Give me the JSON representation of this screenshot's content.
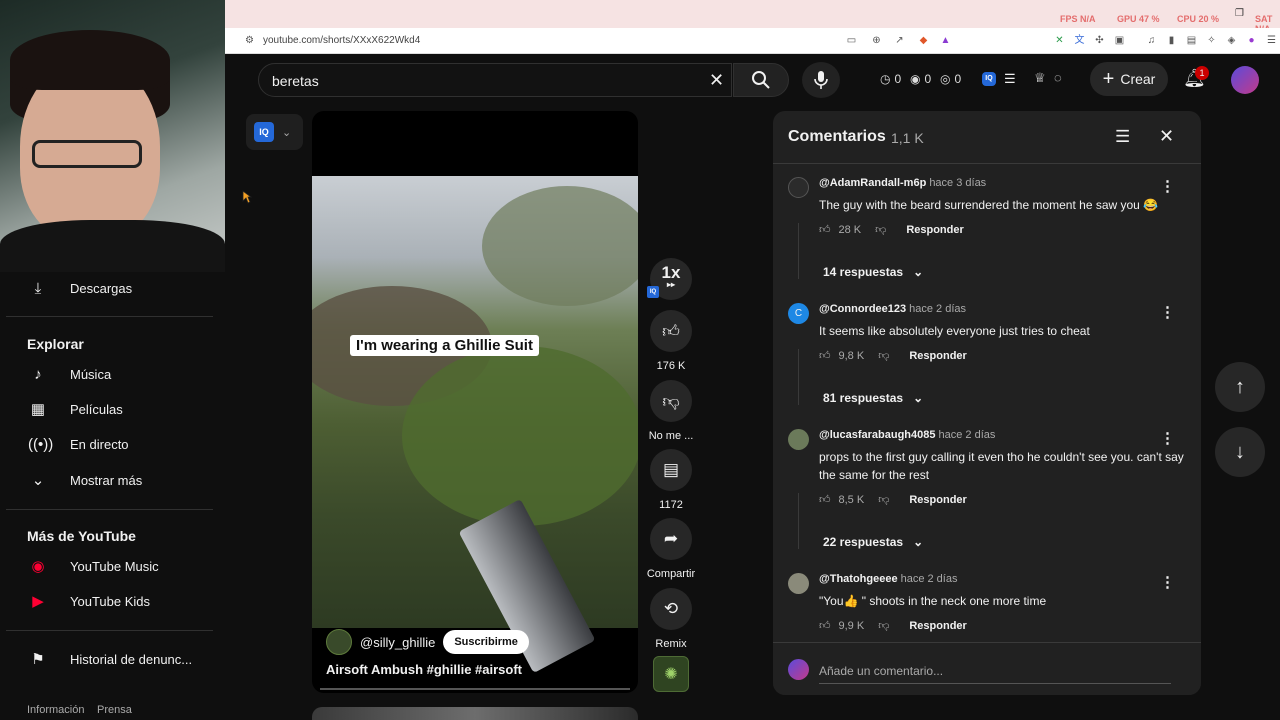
{
  "browser": {
    "url": "youtube.com/shorts/XXxX622Wkd4",
    "hud": {
      "fps_label": "FPS N/A",
      "gpu_label": "GPU 47 %",
      "cpu_label": "CPU 20 %",
      "extra": "SAT N/A"
    }
  },
  "header": {
    "search_value": "beretas",
    "stats": [
      "0",
      "0",
      "0"
    ],
    "create_label": "Crear",
    "notification_count": "1"
  },
  "sidebar": {
    "downloads": "Descargas",
    "explore_heading": "Explorar",
    "explore_items": [
      "Música",
      "Películas",
      "En directo",
      "Mostrar más"
    ],
    "more_heading": "Más de YouTube",
    "more_items": [
      "YouTube Music",
      "YouTube Kids"
    ],
    "report_history": "Historial de denunc...",
    "footer": [
      "Información",
      "Prensa"
    ]
  },
  "short": {
    "caption_overlay": "I'm wearing a Ghillie Suit",
    "channel": "@silly_ghillie",
    "subscribe_label": "Suscribirme",
    "title_plain": "Airsoft Ambush ",
    "hashtags": "#ghillie #airsoft",
    "speed": "1x",
    "likes": "176 K",
    "dislike_label": "No me ...",
    "comments_count": "1172",
    "share_label": "Compartir",
    "remix_label": "Remix"
  },
  "comments": {
    "title": "Comentarios",
    "count": "1,1 K",
    "add_placeholder": "Añade un comentario...",
    "reply_label": "Responder",
    "items": [
      {
        "user": "@AdamRandall-m6p",
        "time": "hace 3 días",
        "text": "The guy with the beard surrendered the moment he saw you 😂",
        "likes": "28 K",
        "replies": "14 respuestas"
      },
      {
        "user": "@Connordee123",
        "time": "hace 2 días",
        "text": "It seems like absolutely everyone just tries to cheat",
        "likes": "9,8 K",
        "replies": "81 respuestas"
      },
      {
        "user": "@lucasfarabaugh4085",
        "time": "hace 2 días",
        "text": "props to the first guy calling it even tho he couldn't see you. can't say the same for the rest",
        "likes": "8,5 K",
        "replies": "22 respuestas"
      },
      {
        "user": "@Thatohgeeee",
        "time": "hace 2 días",
        "text": "\"You👍 \" shoots in the neck one more time",
        "likes": "9,9 K",
        "replies": ""
      }
    ]
  },
  "colors": {
    "accent_red": "#cc0000",
    "iq_blue": "#2468d8",
    "panel_bg": "#212121",
    "page_bg": "#0f0f0f"
  }
}
